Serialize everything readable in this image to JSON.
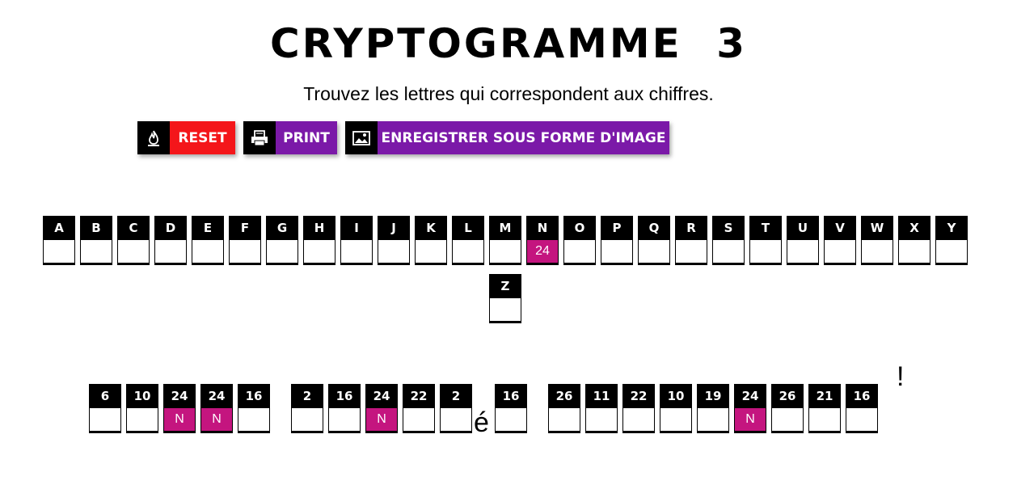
{
  "header": {
    "title": "CRYPTOGRAMME  3",
    "instructions": "Trouvez les lettres qui correspondent aux chiffres."
  },
  "toolbar": {
    "reset_label": "RESET",
    "print_label": "PRINT",
    "save_image_label": "ENREGISTRER SOUS FORME D'IMAGE"
  },
  "colors": {
    "accent_red": "#f4161a",
    "accent_purple": "#7b19a8",
    "revealed_magenta": "#c4157f"
  },
  "alphabet": [
    {
      "letter": "A",
      "code": ""
    },
    {
      "letter": "B",
      "code": ""
    },
    {
      "letter": "C",
      "code": ""
    },
    {
      "letter": "D",
      "code": ""
    },
    {
      "letter": "E",
      "code": ""
    },
    {
      "letter": "F",
      "code": ""
    },
    {
      "letter": "G",
      "code": ""
    },
    {
      "letter": "H",
      "code": ""
    },
    {
      "letter": "I",
      "code": ""
    },
    {
      "letter": "J",
      "code": ""
    },
    {
      "letter": "K",
      "code": ""
    },
    {
      "letter": "L",
      "code": ""
    },
    {
      "letter": "M",
      "code": ""
    },
    {
      "letter": "N",
      "code": "24"
    },
    {
      "letter": "O",
      "code": ""
    },
    {
      "letter": "P",
      "code": ""
    },
    {
      "letter": "Q",
      "code": ""
    },
    {
      "letter": "R",
      "code": ""
    },
    {
      "letter": "S",
      "code": ""
    },
    {
      "letter": "T",
      "code": ""
    },
    {
      "letter": "U",
      "code": ""
    },
    {
      "letter": "V",
      "code": ""
    },
    {
      "letter": "W",
      "code": ""
    },
    {
      "letter": "X",
      "code": ""
    },
    {
      "letter": "Y",
      "code": ""
    },
    {
      "letter": "Z",
      "code": ""
    }
  ],
  "puzzle": {
    "words": [
      [
        {
          "code": "6",
          "letter": ""
        },
        {
          "code": "10",
          "letter": ""
        },
        {
          "code": "24",
          "letter": "N"
        },
        {
          "code": "24",
          "letter": "N"
        },
        {
          "code": "16",
          "letter": ""
        }
      ],
      [
        {
          "code": "2",
          "letter": ""
        },
        {
          "code": "16",
          "letter": ""
        },
        {
          "code": "24",
          "letter": "N"
        },
        {
          "code": "22",
          "letter": ""
        },
        {
          "code": "2",
          "letter": ""
        }
      ],
      [
        {
          "code": "16",
          "letter": ""
        }
      ],
      [
        {
          "code": "26",
          "letter": ""
        },
        {
          "code": "11",
          "letter": ""
        },
        {
          "code": "22",
          "letter": ""
        },
        {
          "code": "10",
          "letter": ""
        },
        {
          "code": "19",
          "letter": ""
        },
        {
          "code": "24",
          "letter": "N"
        },
        {
          "code": "26",
          "letter": ""
        },
        {
          "code": "21",
          "letter": ""
        },
        {
          "code": "16",
          "letter": ""
        }
      ]
    ],
    "fixed_char": "é",
    "exclamation": "!"
  }
}
